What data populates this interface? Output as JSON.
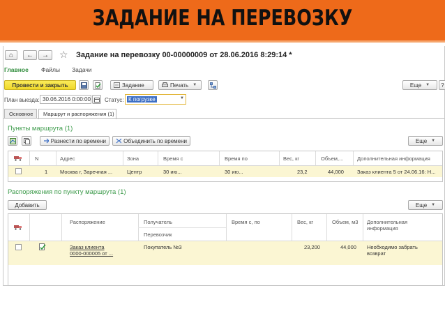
{
  "banner": {
    "title": "ЗАДАНИЕ НА ПЕРЕВОЗКУ"
  },
  "window": {
    "title": "Задание на перевозку 00-00000009 от 28.06.2016 8:29:14 *",
    "back": "←",
    "forward": "→",
    "home": "⌂",
    "star": "☆"
  },
  "nav": {
    "items": [
      "Главное",
      "Файлы",
      "Задачи"
    ]
  },
  "toolbar": {
    "post_close": "Провести и закрыть",
    "task": "Задание",
    "print": "Печать",
    "more": "Еще",
    "help": "?"
  },
  "form": {
    "plan_label": "План выезда:",
    "plan_value": "30.06.2016  0:00:00",
    "status_label": "Статус:",
    "status_value": "К погрузке"
  },
  "form_tabs": [
    "Основное",
    "Маршрут и распоряжения (1)"
  ],
  "route": {
    "title": "Пункты маршрута (1)",
    "btn_distribute": "Разнести по времени",
    "btn_merge": "Объединить по времени",
    "more": "Еще",
    "columns": [
      "N",
      "Адрес",
      "Зона",
      "Время с",
      "Время по",
      "Вес, кг",
      "Объем,...",
      "Дополнительная информация"
    ],
    "rows": [
      {
        "n": "1",
        "address": "Москва г, Заречная ...",
        "zone": "Центр",
        "time_from": "30 ию...",
        "time_to": "30 ию...",
        "weight": "23,2",
        "volume": "44,000",
        "info": "Заказ клиента 5 от 24.06.16: Н..."
      }
    ]
  },
  "orders": {
    "title": "Распоряжения по пункту маршрута (1)",
    "add": "Добавить",
    "more": "Еще",
    "columns": {
      "order": "Распоряжение",
      "recipient": "Получатель",
      "carrier": "Перевозчик",
      "time_from_to": "Время с, по",
      "weight": "Вес, кг",
      "volume": "Объем, м3",
      "info": "Дополнительная информация"
    },
    "rows": [
      {
        "order_line1": "Заказ клиента",
        "order_line2": "0000-000005 от ...",
        "recipient": "Покупатель №3",
        "weight": "23,200",
        "volume": "44,000",
        "info_line1": "Необходимо забрать",
        "info_line2": "возврат"
      }
    ]
  },
  "colors": {
    "banner": "#ee6a1a",
    "accent_green": "#3d9b4b",
    "post_button": "#f4e13a",
    "selected_row": "#fbf6d3"
  }
}
